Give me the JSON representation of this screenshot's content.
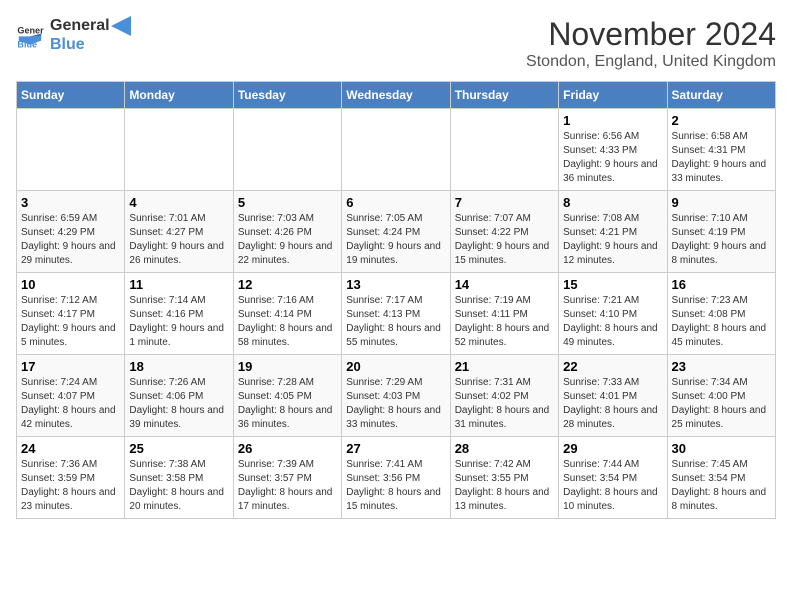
{
  "logo": {
    "text_general": "General",
    "text_blue": "Blue"
  },
  "header": {
    "month": "November 2024",
    "location": "Stondon, England, United Kingdom"
  },
  "weekdays": [
    "Sunday",
    "Monday",
    "Tuesday",
    "Wednesday",
    "Thursday",
    "Friday",
    "Saturday"
  ],
  "weeks": [
    [
      {
        "day": "",
        "sunrise": "",
        "sunset": "",
        "daylight": ""
      },
      {
        "day": "",
        "sunrise": "",
        "sunset": "",
        "daylight": ""
      },
      {
        "day": "",
        "sunrise": "",
        "sunset": "",
        "daylight": ""
      },
      {
        "day": "",
        "sunrise": "",
        "sunset": "",
        "daylight": ""
      },
      {
        "day": "",
        "sunrise": "",
        "sunset": "",
        "daylight": ""
      },
      {
        "day": "1",
        "sunrise": "Sunrise: 6:56 AM",
        "sunset": "Sunset: 4:33 PM",
        "daylight": "Daylight: 9 hours and 36 minutes."
      },
      {
        "day": "2",
        "sunrise": "Sunrise: 6:58 AM",
        "sunset": "Sunset: 4:31 PM",
        "daylight": "Daylight: 9 hours and 33 minutes."
      }
    ],
    [
      {
        "day": "3",
        "sunrise": "Sunrise: 6:59 AM",
        "sunset": "Sunset: 4:29 PM",
        "daylight": "Daylight: 9 hours and 29 minutes."
      },
      {
        "day": "4",
        "sunrise": "Sunrise: 7:01 AM",
        "sunset": "Sunset: 4:27 PM",
        "daylight": "Daylight: 9 hours and 26 minutes."
      },
      {
        "day": "5",
        "sunrise": "Sunrise: 7:03 AM",
        "sunset": "Sunset: 4:26 PM",
        "daylight": "Daylight: 9 hours and 22 minutes."
      },
      {
        "day": "6",
        "sunrise": "Sunrise: 7:05 AM",
        "sunset": "Sunset: 4:24 PM",
        "daylight": "Daylight: 9 hours and 19 minutes."
      },
      {
        "day": "7",
        "sunrise": "Sunrise: 7:07 AM",
        "sunset": "Sunset: 4:22 PM",
        "daylight": "Daylight: 9 hours and 15 minutes."
      },
      {
        "day": "8",
        "sunrise": "Sunrise: 7:08 AM",
        "sunset": "Sunset: 4:21 PM",
        "daylight": "Daylight: 9 hours and 12 minutes."
      },
      {
        "day": "9",
        "sunrise": "Sunrise: 7:10 AM",
        "sunset": "Sunset: 4:19 PM",
        "daylight": "Daylight: 9 hours and 8 minutes."
      }
    ],
    [
      {
        "day": "10",
        "sunrise": "Sunrise: 7:12 AM",
        "sunset": "Sunset: 4:17 PM",
        "daylight": "Daylight: 9 hours and 5 minutes."
      },
      {
        "day": "11",
        "sunrise": "Sunrise: 7:14 AM",
        "sunset": "Sunset: 4:16 PM",
        "daylight": "Daylight: 9 hours and 1 minute."
      },
      {
        "day": "12",
        "sunrise": "Sunrise: 7:16 AM",
        "sunset": "Sunset: 4:14 PM",
        "daylight": "Daylight: 8 hours and 58 minutes."
      },
      {
        "day": "13",
        "sunrise": "Sunrise: 7:17 AM",
        "sunset": "Sunset: 4:13 PM",
        "daylight": "Daylight: 8 hours and 55 minutes."
      },
      {
        "day": "14",
        "sunrise": "Sunrise: 7:19 AM",
        "sunset": "Sunset: 4:11 PM",
        "daylight": "Daylight: 8 hours and 52 minutes."
      },
      {
        "day": "15",
        "sunrise": "Sunrise: 7:21 AM",
        "sunset": "Sunset: 4:10 PM",
        "daylight": "Daylight: 8 hours and 49 minutes."
      },
      {
        "day": "16",
        "sunrise": "Sunrise: 7:23 AM",
        "sunset": "Sunset: 4:08 PM",
        "daylight": "Daylight: 8 hours and 45 minutes."
      }
    ],
    [
      {
        "day": "17",
        "sunrise": "Sunrise: 7:24 AM",
        "sunset": "Sunset: 4:07 PM",
        "daylight": "Daylight: 8 hours and 42 minutes."
      },
      {
        "day": "18",
        "sunrise": "Sunrise: 7:26 AM",
        "sunset": "Sunset: 4:06 PM",
        "daylight": "Daylight: 8 hours and 39 minutes."
      },
      {
        "day": "19",
        "sunrise": "Sunrise: 7:28 AM",
        "sunset": "Sunset: 4:05 PM",
        "daylight": "Daylight: 8 hours and 36 minutes."
      },
      {
        "day": "20",
        "sunrise": "Sunrise: 7:29 AM",
        "sunset": "Sunset: 4:03 PM",
        "daylight": "Daylight: 8 hours and 33 minutes."
      },
      {
        "day": "21",
        "sunrise": "Sunrise: 7:31 AM",
        "sunset": "Sunset: 4:02 PM",
        "daylight": "Daylight: 8 hours and 31 minutes."
      },
      {
        "day": "22",
        "sunrise": "Sunrise: 7:33 AM",
        "sunset": "Sunset: 4:01 PM",
        "daylight": "Daylight: 8 hours and 28 minutes."
      },
      {
        "day": "23",
        "sunrise": "Sunrise: 7:34 AM",
        "sunset": "Sunset: 4:00 PM",
        "daylight": "Daylight: 8 hours and 25 minutes."
      }
    ],
    [
      {
        "day": "24",
        "sunrise": "Sunrise: 7:36 AM",
        "sunset": "Sunset: 3:59 PM",
        "daylight": "Daylight: 8 hours and 23 minutes."
      },
      {
        "day": "25",
        "sunrise": "Sunrise: 7:38 AM",
        "sunset": "Sunset: 3:58 PM",
        "daylight": "Daylight: 8 hours and 20 minutes."
      },
      {
        "day": "26",
        "sunrise": "Sunrise: 7:39 AM",
        "sunset": "Sunset: 3:57 PM",
        "daylight": "Daylight: 8 hours and 17 minutes."
      },
      {
        "day": "27",
        "sunrise": "Sunrise: 7:41 AM",
        "sunset": "Sunset: 3:56 PM",
        "daylight": "Daylight: 8 hours and 15 minutes."
      },
      {
        "day": "28",
        "sunrise": "Sunrise: 7:42 AM",
        "sunset": "Sunset: 3:55 PM",
        "daylight": "Daylight: 8 hours and 13 minutes."
      },
      {
        "day": "29",
        "sunrise": "Sunrise: 7:44 AM",
        "sunset": "Sunset: 3:54 PM",
        "daylight": "Daylight: 8 hours and 10 minutes."
      },
      {
        "day": "30",
        "sunrise": "Sunrise: 7:45 AM",
        "sunset": "Sunset: 3:54 PM",
        "daylight": "Daylight: 8 hours and 8 minutes."
      }
    ]
  ]
}
